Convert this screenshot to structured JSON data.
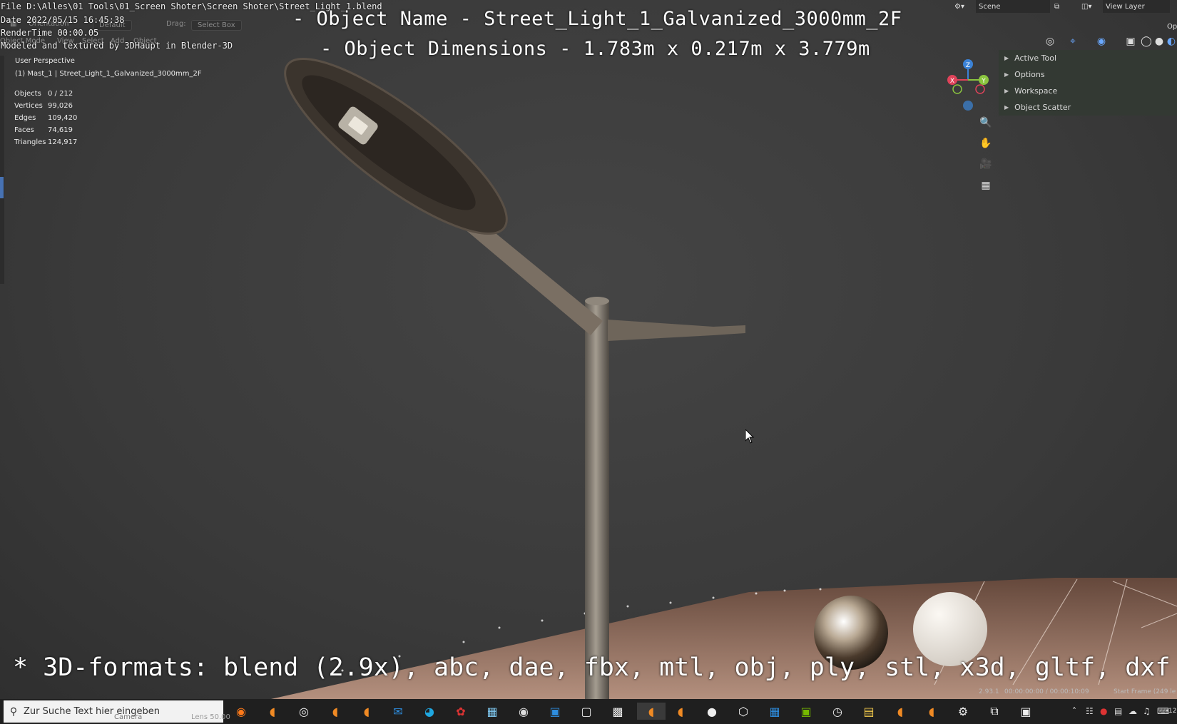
{
  "overlay": {
    "file_line": "File D:\\Alles\\01 Tools\\01_Screen Shoter\\Screen Shoter\\Street_Light_1.blend",
    "date_line": "Date 2022/05/15 16:45:38",
    "render_line": "RenderTime 00:00.05",
    "credit_line": "Modeled and textured by 3DHaupt in Blender-3D",
    "object_name_line": "- Object Name - Street_Light_1_Galvanized_3000mm_2F",
    "dimensions_line": "- Object Dimensions -  1.783m x 0.217m x 3.779m",
    "formats_line": "* 3D-formats: blend (2.9x), abc, dae, fbx, mtl, obj, ply, stl, x3d, gltf, dxf"
  },
  "header": {
    "orientation_label": "Orientation",
    "default_label": "Default",
    "drag_label": "Drag:",
    "select_box_label": "Select Box",
    "mode_label": "Object Mode",
    "view_menu": "View",
    "select_menu": "Select",
    "add_menu": "Add",
    "object_menu": "Object",
    "scene_label": "Scene",
    "view_layer_label": "View Layer",
    "options_label": "Op"
  },
  "viewport_info": {
    "perspective": "User Perspective",
    "active_object": "(1) Mast_1 | Street_Light_1_Galvanized_3000mm_2F"
  },
  "stats": [
    {
      "label": "Objects",
      "value": "0 / 212"
    },
    {
      "label": "Vertices",
      "value": "99,026"
    },
    {
      "label": "Edges",
      "value": "109,420"
    },
    {
      "label": "Faces",
      "value": "74,619"
    },
    {
      "label": "Triangles",
      "value": "124,917"
    }
  ],
  "n_panel": {
    "items": [
      "Active Tool",
      "Options",
      "Workspace",
      "Object Scatter"
    ]
  },
  "gizmo": {
    "z": "Z",
    "x": "X",
    "y": "Y",
    "x_color": "#e0435a",
    "y_color": "#8bc53f",
    "z_color": "#3b82d6"
  },
  "status": {
    "version": "2.93.1",
    "timecode": "00:00:00:00 / 00:00:10:09",
    "start_frame": "Start Frame (249 le"
  },
  "taskbar": {
    "search_placeholder": "Zur Suche Text hier eingeben",
    "faint_camera": "Camera",
    "faint_lens": "Lens 50.00",
    "clock": "12:"
  }
}
